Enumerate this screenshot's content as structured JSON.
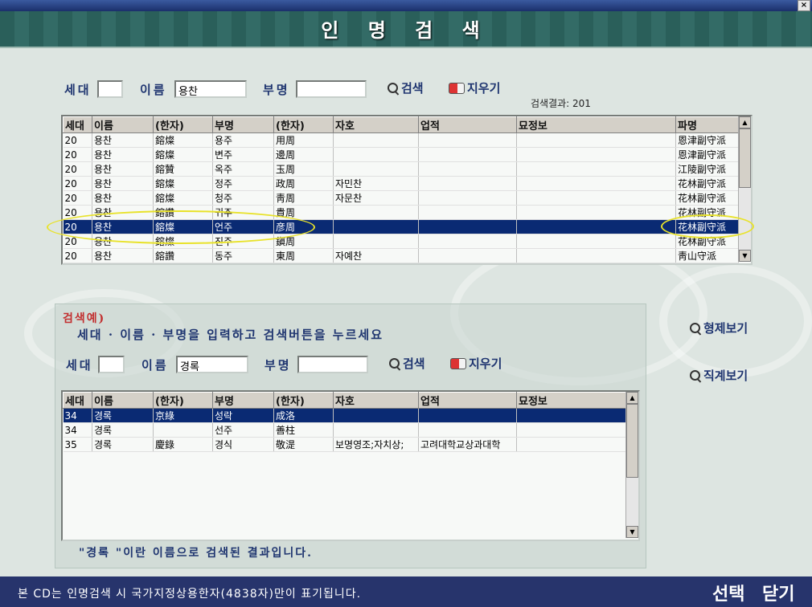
{
  "window": {
    "title": "인 명 검 색",
    "close": "×"
  },
  "search": {
    "gen_label": "세대",
    "name_label": "이름",
    "father_label": "부명",
    "gen_value": "",
    "name_value": "용찬",
    "father_value": "",
    "search_btn": "검색",
    "clear_btn": "지우기",
    "result_count": "검색결과:  201"
  },
  "results": {
    "columns": [
      "세대",
      "이름",
      "(한자)",
      "부명",
      "(한자)",
      "자호",
      "업적",
      "묘정보",
      "파명"
    ],
    "rows": [
      [
        "20",
        "용찬",
        "鎔燦",
        "용주",
        "用周",
        "",
        "",
        "",
        "恩津副守派"
      ],
      [
        "20",
        "용찬",
        "鎔燦",
        "변주",
        "邊周",
        "",
        "",
        "",
        "恩津副守派"
      ],
      [
        "20",
        "용찬",
        "鎔贊",
        "옥주",
        "玉周",
        "",
        "",
        "",
        "江陵副守派"
      ],
      [
        "20",
        "용찬",
        "鎔燦",
        "정주",
        "政周",
        "자민찬",
        "",
        "",
        "花林副守派"
      ],
      [
        "20",
        "용찬",
        "鎔燦",
        "청주",
        "靑周",
        "자문찬",
        "",
        "",
        "花林副守派"
      ],
      [
        "20",
        "용찬",
        "鎔讚",
        "귀주",
        "貴周",
        "",
        "",
        "",
        "花林副守派"
      ],
      [
        "20",
        "용찬",
        "鎔燦",
        "언주",
        "彦周",
        "",
        "",
        "",
        "花林副守派"
      ],
      [
        "20",
        "용찬",
        "鎔燦",
        "진주",
        "鎭周",
        "",
        "",
        "",
        "花林副守派"
      ],
      [
        "20",
        "용찬",
        "鎔讚",
        "동주",
        "東周",
        "자예찬",
        "",
        "",
        "靑山守派"
      ]
    ],
    "selected_index": 6
  },
  "example": {
    "title": "검색예)",
    "description": "세대 · 이름 · 부명을 입력하고 검색버튼을 누르세요",
    "gen_label": "세대",
    "name_label": "이름",
    "father_label": "부명",
    "gen_value": "",
    "name_value": "경록",
    "father_value": "",
    "search_btn": "검색",
    "clear_btn": "지우기",
    "columns": [
      "세대",
      "이름",
      "(한자)",
      "부명",
      "(한자)",
      "자호",
      "업적",
      "묘정보"
    ],
    "rows": [
      [
        "34",
        "경록",
        "京綠",
        "성락",
        "成洛",
        "",
        "",
        ""
      ],
      [
        "34",
        "경록",
        "",
        "선주",
        "善柱",
        "",
        "",
        ""
      ],
      [
        "35",
        "경록",
        "慶錄",
        "경식",
        "敬湜",
        "보명영조;자치상;",
        "고려대학교상과대학",
        ""
      ]
    ],
    "selected_index": 0,
    "message": "\"경록 \"이란 이름으로 검색된 결과입니다."
  },
  "side": {
    "sibling_view": "형제보기",
    "lineage_view": "직계보기"
  },
  "footer": {
    "notice": "본 CD는 인명검색 시 국가지정상용한자(4838자)만이 표기됩니다.",
    "select": "선택",
    "close": "닫기"
  }
}
